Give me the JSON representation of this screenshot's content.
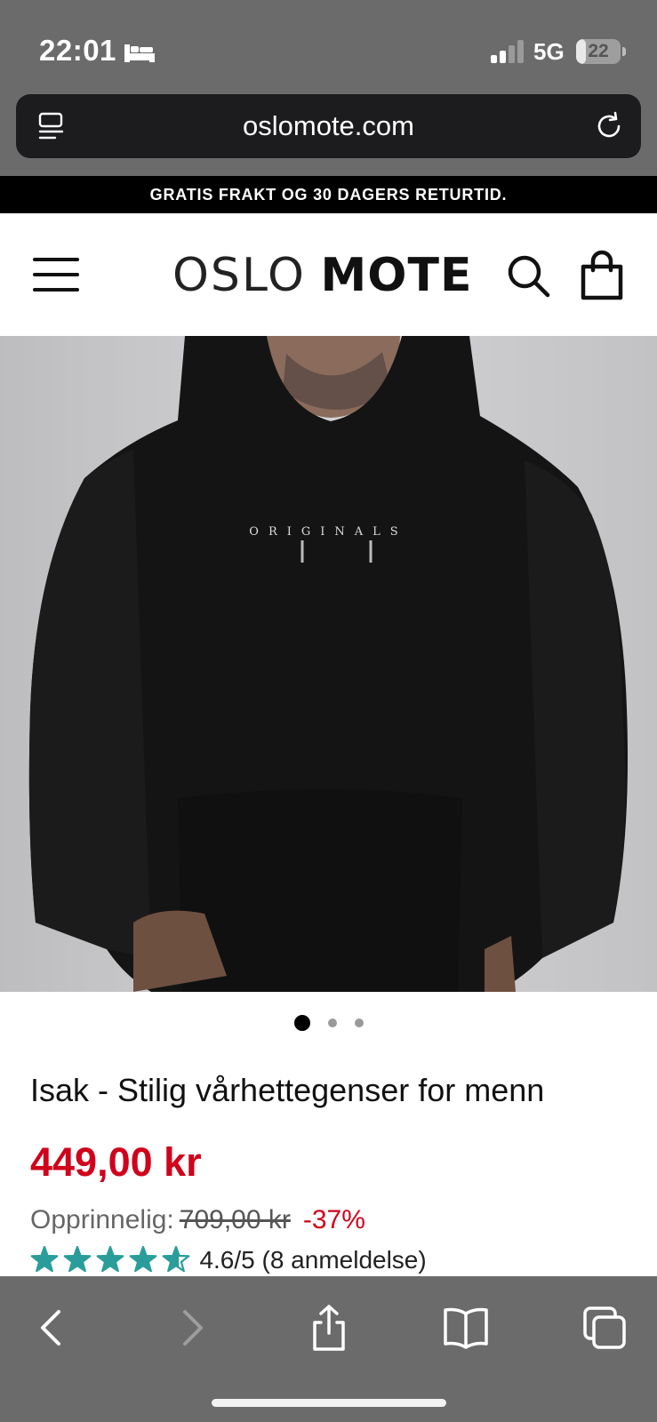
{
  "status": {
    "time": "22:01",
    "network": "5G",
    "battery": "22",
    "battery_level": 0.22
  },
  "browser": {
    "url": "oslomote.com"
  },
  "promo": {
    "text": "GRATIS FRAKT OG 30 DAGERS RETURTID."
  },
  "header": {
    "logo_light": "OSLO",
    "logo_bold": "MOTE"
  },
  "hero": {
    "print_text": "ORIGINALS",
    "dots_count": 3,
    "active_index": 0
  },
  "product": {
    "title": "Isak - Stilig vårhettegenser for menn",
    "price": "449,00 kr",
    "original_label": "Opprinnelig:",
    "original_price": "709,00 kr",
    "discount": "-37%",
    "rating": 4.6,
    "rating_text": "4.6/5 (8 anmeldelse)"
  },
  "colors": {
    "accent_red": "#d0021b",
    "star_teal": "#2a9d9a",
    "chrome_gray": "#6b6b6b"
  }
}
